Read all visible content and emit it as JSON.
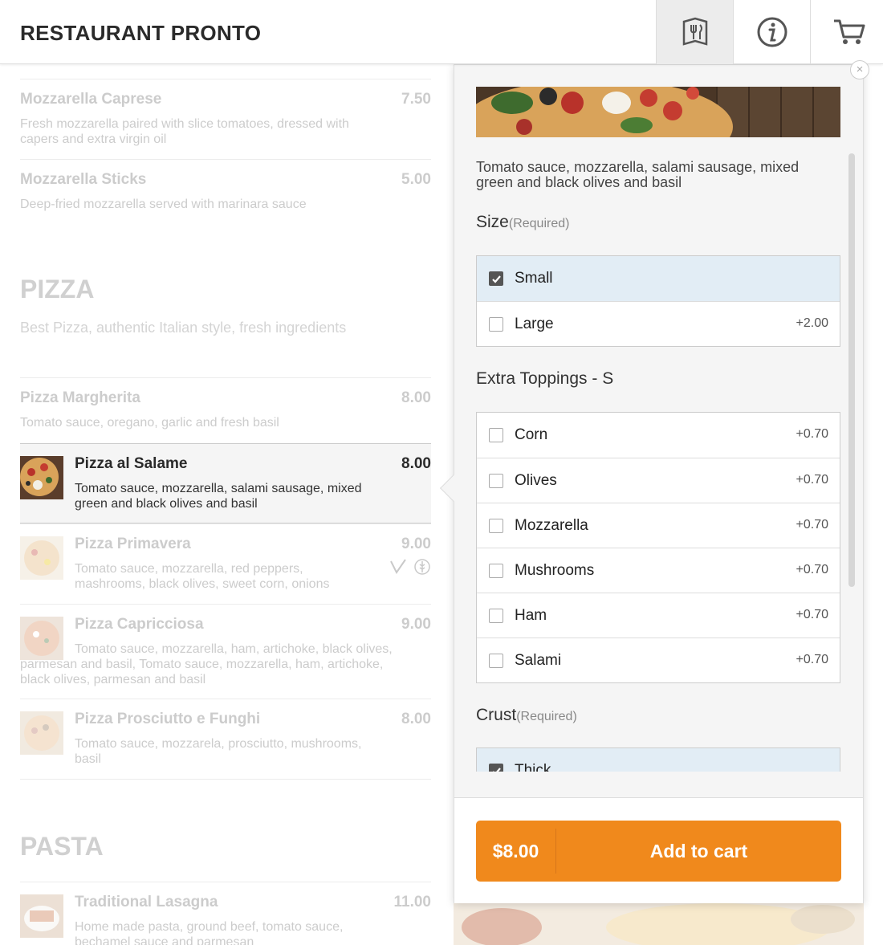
{
  "header": {
    "brand": "RESTAURANT PRONTO",
    "menu_icon": "menu-book-icon",
    "info_icon": "info-icon",
    "cart_icon": "cart-icon"
  },
  "menu": {
    "starters": [
      {
        "name": "Mozzarella Caprese",
        "price": "7.50",
        "desc": "Fresh mozzarella paired with slice tomatoes, dressed with capers and extra virgin oil"
      },
      {
        "name": "Mozzarella Sticks",
        "price": "5.00",
        "desc": "Deep-fried mozzarella served with marinara sauce"
      }
    ],
    "pizza_section": {
      "title": "PIZZA",
      "subtitle": "Best Pizza, authentic Italian style, fresh ingredients"
    },
    "pizzas": [
      {
        "name": "Pizza Margherita",
        "price": "8.00",
        "desc": "Tomato sauce, oregano, garlic and fresh basil"
      },
      {
        "name": "Pizza al Salame",
        "price": "8.00",
        "desc": "Tomato sauce, mozzarella, salami sausage, mixed green and black olives and basil"
      },
      {
        "name": "Pizza Primavera",
        "price": "9.00",
        "desc": "Tomato sauce, mozzarella, red peppers, mashrooms, black olives, sweet corn, onions"
      },
      {
        "name": "Pizza Capricciosa",
        "price": "9.00",
        "desc": "Tomato sauce, mozzarella, ham, artichoke, black olives, parmesan and basil, Tomato sauce, mozzarella, ham, artichoke, black olives, parmesan and basil"
      },
      {
        "name": "Pizza Prosciutto e Funghi",
        "price": "8.00",
        "desc": "Tomato sauce, mozzarela, prosciutto, mushrooms, basil"
      }
    ],
    "pasta_section": {
      "title": "PASTA"
    },
    "pastas": [
      {
        "name": "Traditional Lasagna",
        "price": "11.00",
        "desc": "Home made pasta, ground beef, tomato sauce, bechamel sauce and parmesan"
      }
    ]
  },
  "panel": {
    "close_symbol": "×",
    "description": "Tomato sauce, mozzarella, salami sausage, mixed green and black olives and basil",
    "size": {
      "title": "Size",
      "required": "(Required)",
      "options": [
        {
          "label": "Small",
          "price": "",
          "checked": true
        },
        {
          "label": "Large",
          "price": "+2.00",
          "checked": false
        }
      ]
    },
    "toppings": {
      "title": "Extra Toppings - S",
      "options": [
        {
          "label": "Corn",
          "price": "+0.70"
        },
        {
          "label": "Olives",
          "price": "+0.70"
        },
        {
          "label": "Mozzarella",
          "price": "+0.70"
        },
        {
          "label": "Mushrooms",
          "price": "+0.70"
        },
        {
          "label": "Ham",
          "price": "+0.70"
        },
        {
          "label": "Salami",
          "price": "+0.70"
        }
      ]
    },
    "crust": {
      "title": "Crust",
      "required": "(Required)",
      "options": [
        {
          "label": "Thick",
          "checked": true
        }
      ]
    },
    "cart": {
      "price": "$8.00",
      "label": "Add to cart"
    }
  },
  "colors": {
    "accent": "#f0891c",
    "selected_row": "#e2edf5"
  }
}
